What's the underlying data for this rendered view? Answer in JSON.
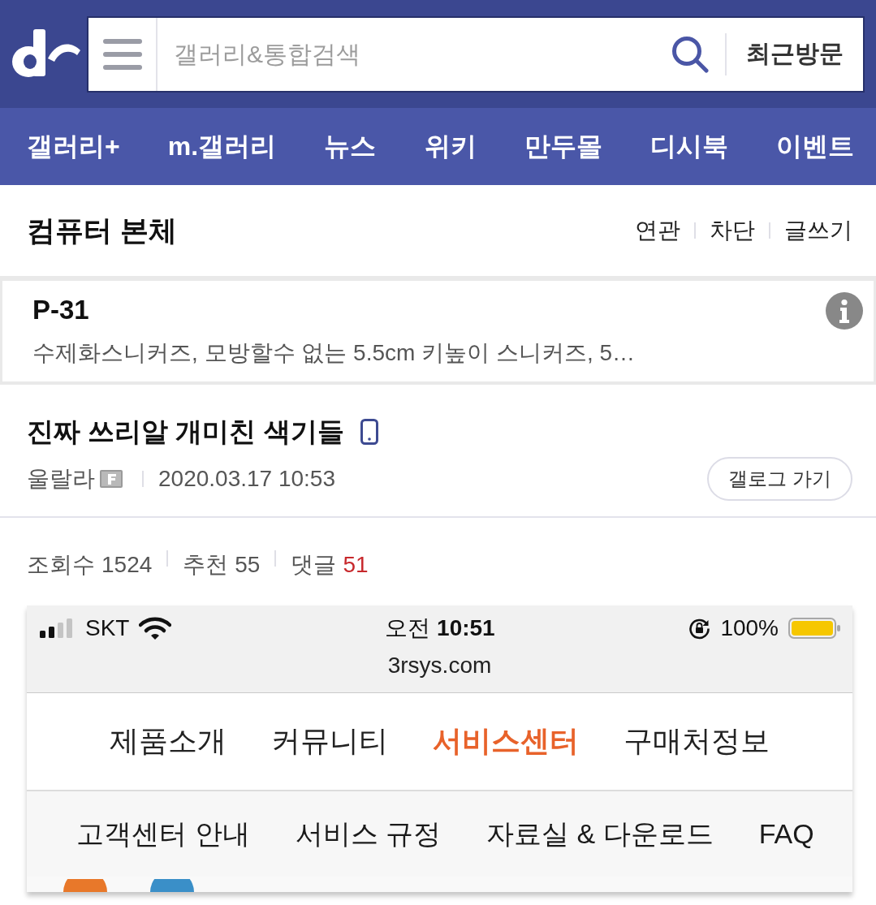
{
  "header": {
    "search": {
      "placeholder": "갤러리&통합검색"
    },
    "recent_button": "최근방문"
  },
  "nav": [
    "갤러리+",
    "m.갤러리",
    "뉴스",
    "위키",
    "만두몰",
    "디시북",
    "이벤트"
  ],
  "gallery": {
    "title": "컴퓨터 본체",
    "actions": [
      "연관",
      "차단",
      "글쓰기"
    ]
  },
  "ad": {
    "title": "P-31",
    "description": "수제화스니커즈, 모방할수 없는 5.5cm 키높이 스니커즈, 5…"
  },
  "post": {
    "title": "진짜 쓰리알 개미친 색기들",
    "author": "울랄라",
    "date": "2020.03.17 10:53",
    "gallog_button": "갤로그 가기"
  },
  "stats": [
    {
      "label": "조회수",
      "value": "1524",
      "highlight": false
    },
    {
      "label": "추천",
      "value": "55",
      "highlight": false
    },
    {
      "label": "댓글",
      "value": "51",
      "highlight": true
    }
  ],
  "screenshot": {
    "status_bar": {
      "carrier": "SKT",
      "time": "오전 **10:51**",
      "battery": "100%"
    },
    "url": "3rsys.com",
    "menu": [
      {
        "label": "제품소개",
        "selected": false
      },
      {
        "label": "커뮤니티",
        "selected": false
      },
      {
        "label": "서비스센터",
        "selected": true
      },
      {
        "label": "구매처정보",
        "selected": false
      }
    ],
    "submenu": [
      "고객센터 안내",
      "서비스 규정",
      "자료실 & 다운로드",
      "FAQ"
    ]
  }
}
